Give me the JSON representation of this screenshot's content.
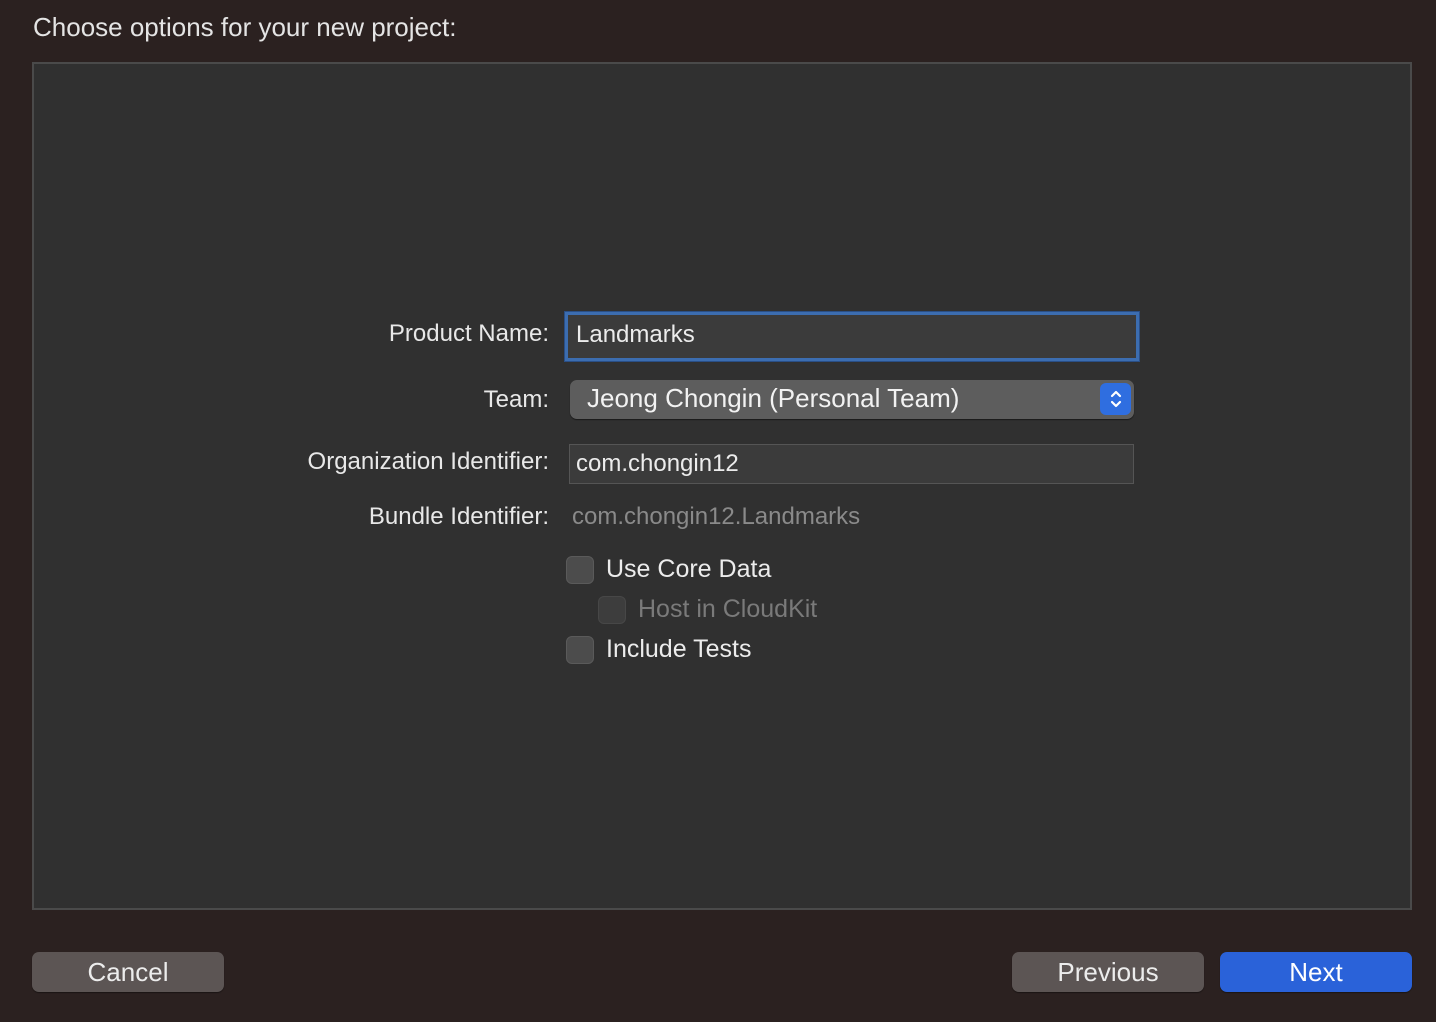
{
  "header": {
    "title": "Choose options for your new project:"
  },
  "form": {
    "product_name": {
      "label": "Product Name:",
      "value": "Landmarks"
    },
    "team": {
      "label": "Team:",
      "selected": "Jeong Chongin (Personal Team)"
    },
    "organization_identifier": {
      "label": "Organization Identifier:",
      "value": "com.chongin12"
    },
    "bundle_identifier": {
      "label": "Bundle Identifier:",
      "value": "com.chongin12.Landmarks"
    },
    "options": {
      "use_core_data": {
        "label": "Use Core Data",
        "checked": false
      },
      "host_in_cloudkit": {
        "label": "Host in CloudKit",
        "checked": false,
        "enabled": false
      },
      "include_tests": {
        "label": "Include Tests",
        "checked": false
      }
    }
  },
  "footer": {
    "cancel_label": "Cancel",
    "previous_label": "Previous",
    "next_label": "Next"
  },
  "colors": {
    "accent": "#2a62d9",
    "focus_ring": "#3c6db0",
    "background": "#2b2120",
    "panel": "#303030"
  },
  "icons": {
    "team_popup": "chevron-up-down-icon"
  }
}
